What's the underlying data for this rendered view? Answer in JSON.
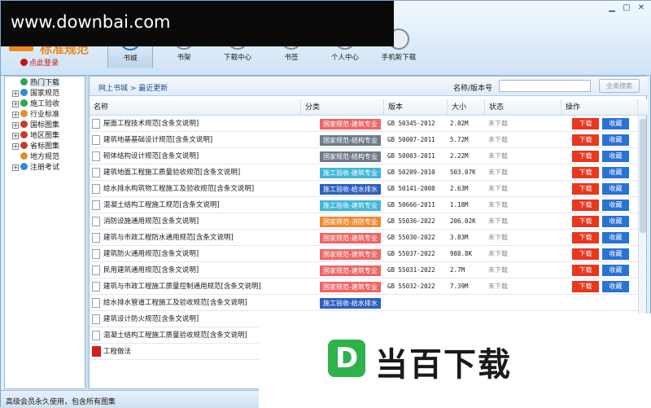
{
  "app": {
    "logo_text": "标准规范",
    "login_label": "点此登录",
    "window_controls": [
      "▁",
      "▢",
      "✕"
    ]
  },
  "watermark_text": "www.downbai.com",
  "nav": [
    {
      "label": "书城",
      "icon": "bookstore-icon",
      "active": true
    },
    {
      "label": "书架",
      "icon": "bookshelf-icon",
      "active": false
    },
    {
      "label": "下载中心",
      "icon": "download-center-icon",
      "active": false
    },
    {
      "label": "书签",
      "icon": "bookmark-icon",
      "active": false
    },
    {
      "label": "个人中心",
      "icon": "user-center-icon",
      "active": false
    },
    {
      "label": "手机新下载",
      "icon": "phone-icon",
      "active": false
    }
  ],
  "tree": [
    {
      "label": "热门下载",
      "color": "#2aa84a",
      "expandable": false,
      "selected": true
    },
    {
      "label": "国家规范",
      "color": "#2d8ad8",
      "expandable": true
    },
    {
      "label": "施工验收",
      "color": "#2aa84a",
      "expandable": true
    },
    {
      "label": "行业标准",
      "color": "#e0902a",
      "expandable": true
    },
    {
      "label": "国标图集",
      "color": "#c9392c",
      "expandable": true
    },
    {
      "label": "地区图集",
      "color": "#c9392c",
      "expandable": true
    },
    {
      "label": "省标图集",
      "color": "#c9392c",
      "expandable": true
    },
    {
      "label": "地方规范",
      "color": "#e0902a",
      "expandable": false
    },
    {
      "label": "注册考试",
      "color": "#2d8ad8",
      "expandable": true
    }
  ],
  "breadcrumb": "网上书城 > 最近更新",
  "search": {
    "label": "名称/版本号",
    "value": "",
    "placeholder": "",
    "button": "全类搜索"
  },
  "columns": [
    "名称",
    "分类",
    "版本",
    "大小",
    "状态",
    "操作"
  ],
  "category_colors": {
    "国家规范-建筑专业": "#ee6666",
    "国家规范-结构专业": "#6f7b8a",
    "施工验收-建筑专业": "#3fb7d8",
    "施工验收-给水排水": "#2c5fc2",
    "国家规范-消防专业": "#f18a33"
  },
  "actions": {
    "download": "下载",
    "favorite": "收藏"
  },
  "rows": [
    {
      "name": "屋面工程技术规范[含条文说明]",
      "category": "国家规范-建筑专业",
      "version": "GB 50345-2012",
      "size": "2.02M",
      "status": "未下载"
    },
    {
      "name": "建筑地基基础设计规范[含条文说明]",
      "category": "国家规范-结构专业",
      "version": "GB 50007-2011",
      "size": "5.72M",
      "status": "未下载"
    },
    {
      "name": "砌体结构设计规范[含条文说明]",
      "category": "国家规范-结构专业",
      "version": "GB 50003-2011",
      "size": "2.22M",
      "status": "未下载"
    },
    {
      "name": "建筑地面工程施工质量验收规范[含条文说明]",
      "category": "施工验收-建筑专业",
      "version": "GB 50209-2010",
      "size": "503.07K",
      "status": "未下载"
    },
    {
      "name": "给水排水构筑物工程施工及验收规范[含条文说明]",
      "category": "施工验收-给水排水",
      "version": "GB 50141-2008",
      "size": "2.63M",
      "status": "未下载"
    },
    {
      "name": "混凝土结构工程施工规范[含条文说明]",
      "category": "施工验收-建筑专业",
      "version": "GB 50666-2011",
      "size": "1.18M",
      "status": "未下载"
    },
    {
      "name": "消防设施通用规范[含条文说明]",
      "category": "国家规范-消防专业",
      "version": "GB 55036-2022",
      "size": "206.02K",
      "status": "未下载"
    },
    {
      "name": "建筑与市政工程防水通用规范[含条文说明]",
      "category": "国家规范-建筑专业",
      "version": "GB 55030-2022",
      "size": "3.83M",
      "status": "未下载"
    },
    {
      "name": "建筑防火通用规范[含条文说明]",
      "category": "国家规范-建筑专业",
      "version": "GB 55037-2022",
      "size": "988.8K",
      "status": "未下载"
    },
    {
      "name": "民用建筑通用规范[含条文说明]",
      "category": "国家规范-建筑专业",
      "version": "GB 55031-2022",
      "size": "2.7M",
      "status": "未下载"
    },
    {
      "name": "建筑与市政工程施工质量控制通用规范[含条文说明]",
      "category": "国家规范-建筑专业",
      "version": "GB 55032-2022",
      "size": "7.39M",
      "status": "未下载"
    },
    {
      "name": "给水排水管道工程施工及验收规范[含条文说明]",
      "category": "施工验收-给水排水",
      "version": "",
      "size": "",
      "status": ""
    },
    {
      "name": "建筑设计防火规范[含条文说明]",
      "category": "",
      "version": "",
      "size": "",
      "status": ""
    },
    {
      "name": "混凝土结构工程施工质量验收规范[含条文说明]",
      "category": "",
      "version": "",
      "size": "",
      "status": ""
    },
    {
      "name": "工程做法",
      "category": "",
      "version": "",
      "size": "",
      "status": "",
      "pdf": true
    }
  ],
  "status_text": "高级会员永久使用，包含所有图集",
  "brand_text": "当百下载",
  "brand_letter": "D"
}
